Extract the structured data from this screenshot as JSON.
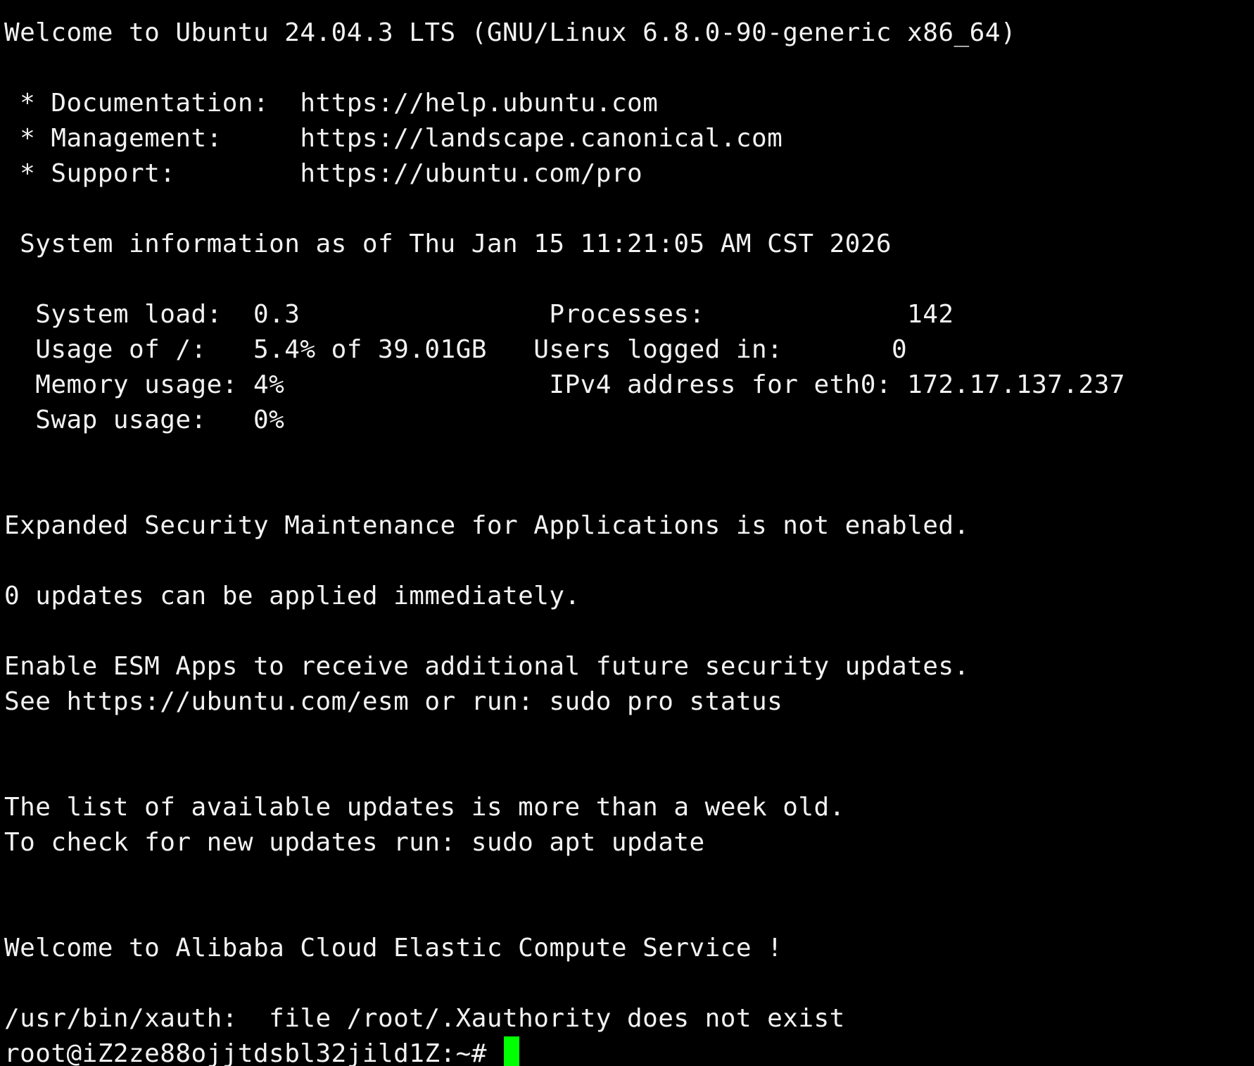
{
  "terminal": {
    "colors": {
      "background": "#000000",
      "foreground": "#f2f2f2",
      "cursor": "#00ff00"
    },
    "lines": [
      "Welcome to Ubuntu 24.04.3 LTS (GNU/Linux 6.8.0-90-generic x86_64)",
      "",
      " * Documentation:  https://help.ubuntu.com",
      " * Management:     https://landscape.canonical.com",
      " * Support:        https://ubuntu.com/pro",
      "",
      " System information as of Thu Jan 15 11:21:05 AM CST 2026",
      "",
      "  System load:  0.3                Processes:             142",
      "  Usage of /:   5.4% of 39.01GB   Users logged in:       0",
      "  Memory usage: 4%                 IPv4 address for eth0: 172.17.137.237",
      "  Swap usage:   0%",
      "",
      "",
      "Expanded Security Maintenance for Applications is not enabled.",
      "",
      "0 updates can be applied immediately.",
      "",
      "Enable ESM Apps to receive additional future security updates.",
      "See https://ubuntu.com/esm or run: sudo pro status",
      "",
      "",
      "The list of available updates is more than a week old.",
      "To check for new updates run: sudo apt update",
      "",
      "",
      "Welcome to Alibaba Cloud Elastic Compute Service !",
      "",
      "/usr/bin/xauth:  file /root/.Xauthority does not exist"
    ],
    "prompt": "root@iZ2ze88ojjtdsbl32jild1Z:~# "
  }
}
